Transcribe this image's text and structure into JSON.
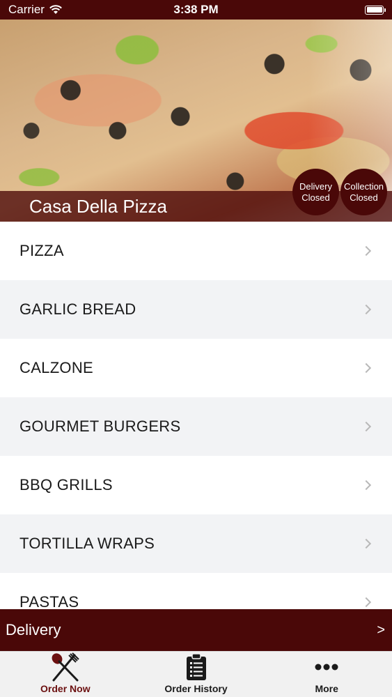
{
  "status": {
    "carrier": "Carrier",
    "time": "3:38 PM"
  },
  "hero": {
    "restaurant_name": "Casa Della Pizza",
    "badges": [
      {
        "line1": "Delivery",
        "line2": "Closed"
      },
      {
        "line1": "Collection",
        "line2": "Closed"
      }
    ]
  },
  "menu": {
    "items": [
      {
        "label": "PIZZA"
      },
      {
        "label": "GARLIC BREAD"
      },
      {
        "label": "CALZONE"
      },
      {
        "label": "GOURMET BURGERS"
      },
      {
        "label": "BBQ GRILLS"
      },
      {
        "label": "TORTILLA WRAPS"
      },
      {
        "label": "PASTAS"
      }
    ]
  },
  "delivery_bar": {
    "label": "Delivery",
    "arrow": ">"
  },
  "tabs": [
    {
      "label": "Order Now",
      "icon": "fork-spoon-icon",
      "active": true
    },
    {
      "label": "Order History",
      "icon": "clipboard-list-icon",
      "active": false
    },
    {
      "label": "More",
      "icon": "more-dots-icon",
      "active": false
    }
  ],
  "colors": {
    "brand": "#4a0808",
    "active_tab": "#6b1010",
    "row_alt": "#f2f3f5"
  }
}
